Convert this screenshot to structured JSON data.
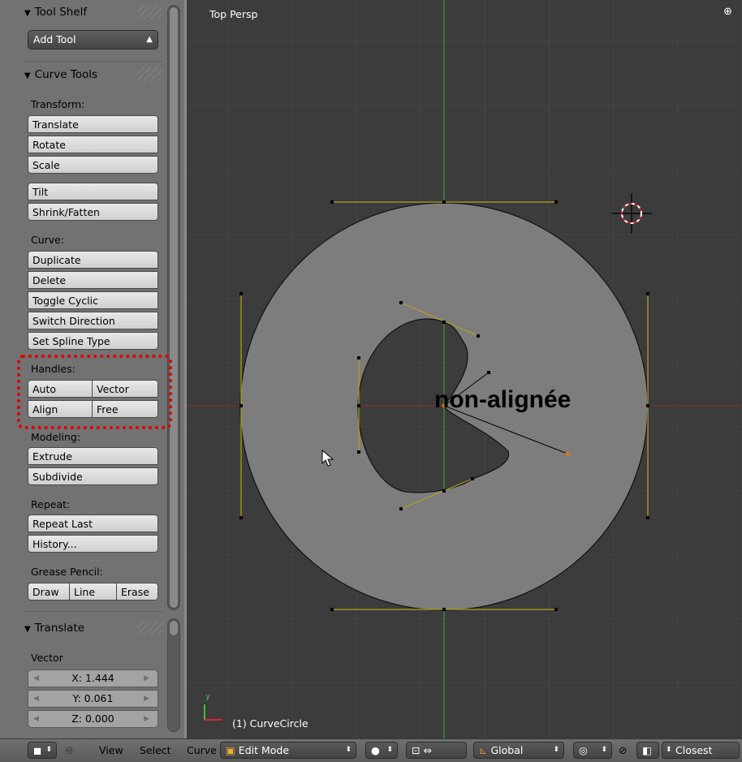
{
  "tool_shelf": {
    "title": "Tool Shelf",
    "add_tool": "Add Tool",
    "curve_tools": {
      "title": "Curve Tools",
      "transform_label": "Transform:",
      "translate": "Translate",
      "rotate": "Rotate",
      "scale": "Scale",
      "tilt": "Tilt",
      "shrink_fatten": "Shrink/Fatten",
      "curve_label": "Curve:",
      "duplicate": "Duplicate",
      "delete": "Delete",
      "toggle_cyclic": "Toggle Cyclic",
      "switch_direction": "Switch Direction",
      "set_spline_type": "Set Spline Type",
      "handles_label": "Handles:",
      "auto": "Auto",
      "vector": "Vector",
      "align": "Align",
      "free": "Free",
      "modeling_label": "Modeling:",
      "extrude": "Extrude",
      "subdivide": "Subdivide",
      "repeat_label": "Repeat:",
      "repeat_last": "Repeat Last",
      "history": "History...",
      "grease_pencil_label": "Grease Pencil:",
      "draw": "Draw",
      "line": "Line",
      "erase": "Erase"
    },
    "operator_panel": {
      "title": "Translate",
      "vector_label": "Vector",
      "x": "X: 1.444",
      "y": "Y: 0.061",
      "z": "Z: 0.000"
    }
  },
  "viewport": {
    "view_name": "Top Persp",
    "object_label": "(1) CurveCircle",
    "annotation": "non-alignée",
    "axis_y": "y"
  },
  "header": {
    "view": "View",
    "select": "Select",
    "curve": "Curve",
    "mode": "Edit Mode",
    "orientation": "Global",
    "snap_target": "Closest"
  },
  "colors": {
    "highlight": "#e00000",
    "handle": "#b5a020",
    "viewport_bg": "#3c3c3c",
    "curve_fill": "#7d7d7d"
  }
}
